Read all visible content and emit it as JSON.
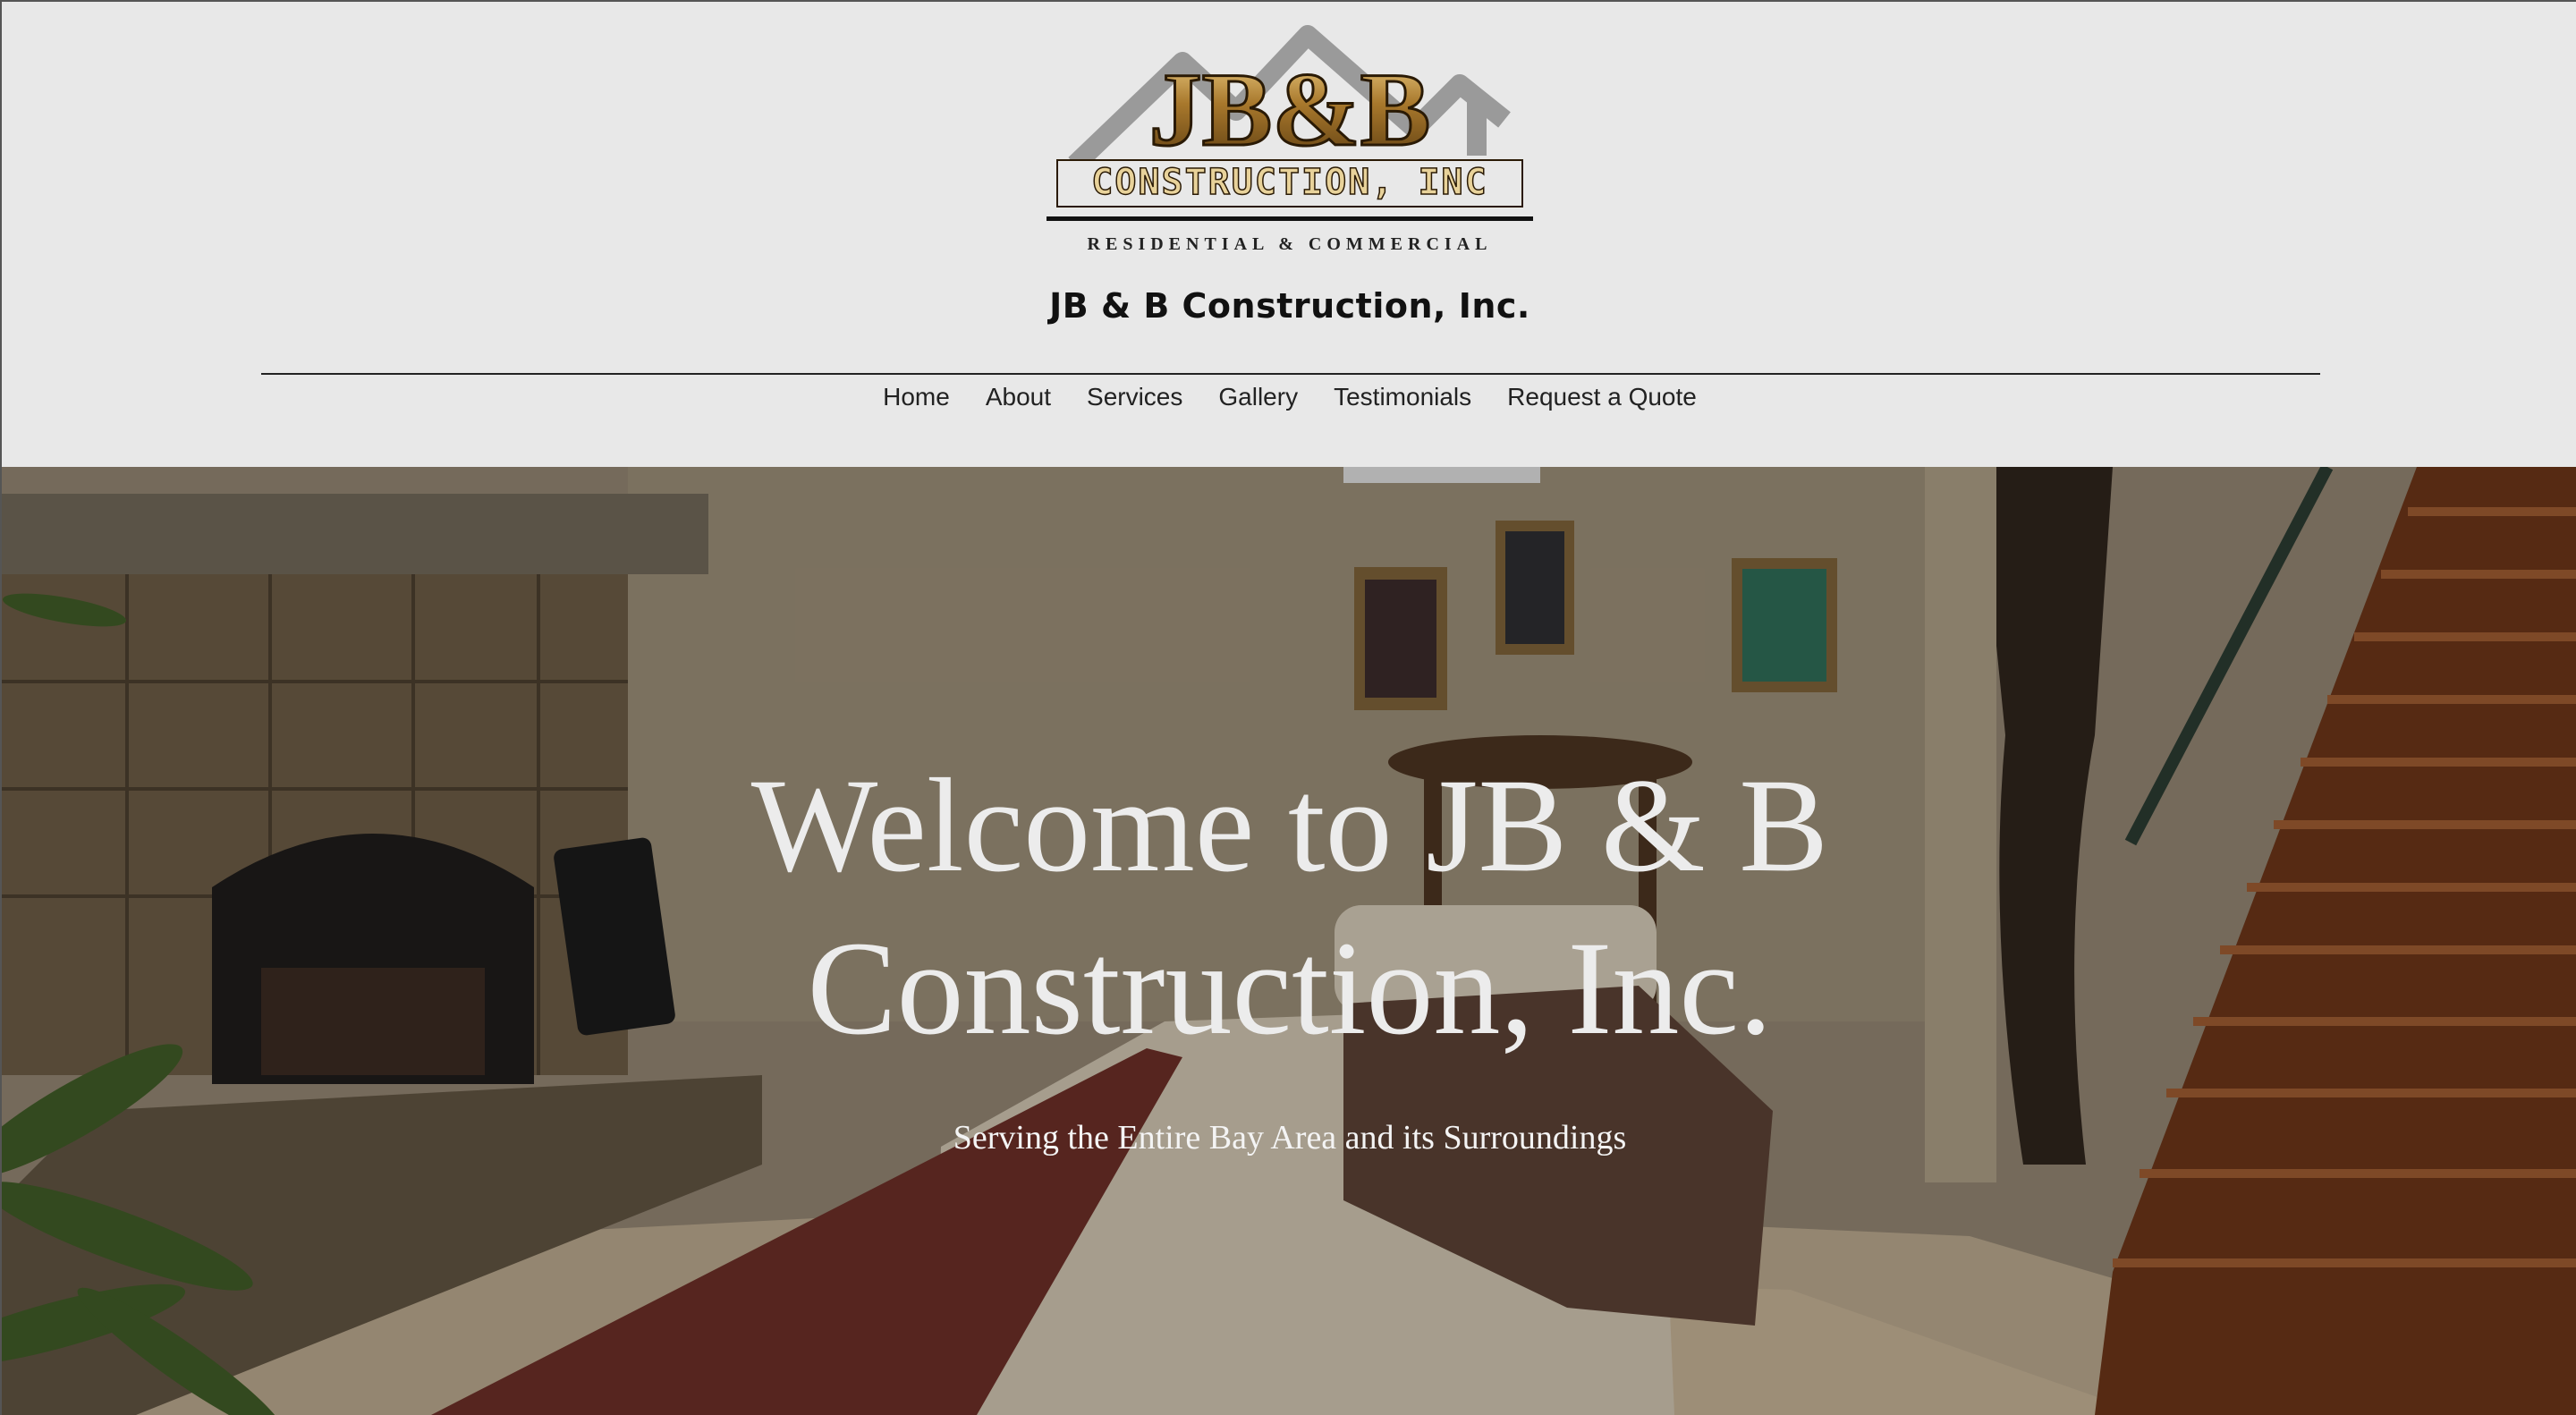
{
  "logo": {
    "brand": "JB&B",
    "name": "CONSTRUCTION, INC",
    "tagline": "RESIDENTIAL & COMMERCIAL"
  },
  "site_title": "JB & B Construction, Inc.",
  "nav": {
    "items": [
      {
        "label": "Home"
      },
      {
        "label": "About"
      },
      {
        "label": "Services"
      },
      {
        "label": "Gallery"
      },
      {
        "label": "Testimonials"
      },
      {
        "label": "Request a Quote"
      }
    ]
  },
  "hero": {
    "title_line1": "Welcome to JB & B",
    "title_line2": "Construction, Inc.",
    "subtitle": "Serving the Entire Bay Area and its Surroundings"
  },
  "colors": {
    "header_bg": "#e8e8e8",
    "text_dark": "#111111",
    "hero_text": "#ececec",
    "logo_gold": "#a8782c"
  }
}
